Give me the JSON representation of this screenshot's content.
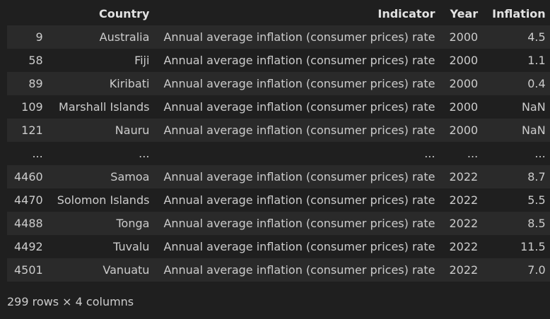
{
  "table": {
    "headers": [
      "",
      "Country",
      "Indicator",
      "Year",
      "Inflation"
    ],
    "rows": [
      {
        "index": "9",
        "country": "Australia",
        "indicator": "Annual average inflation (consumer prices) rate",
        "year": "2000",
        "inflation": "4.5"
      },
      {
        "index": "58",
        "country": "Fiji",
        "indicator": "Annual average inflation (consumer prices) rate",
        "year": "2000",
        "inflation": "1.1"
      },
      {
        "index": "89",
        "country": "Kiribati",
        "indicator": "Annual average inflation (consumer prices) rate",
        "year": "2000",
        "inflation": "0.4"
      },
      {
        "index": "109",
        "country": "Marshall Islands",
        "indicator": "Annual average inflation (consumer prices) rate",
        "year": "2000",
        "inflation": "NaN"
      },
      {
        "index": "121",
        "country": "Nauru",
        "indicator": "Annual average inflation (consumer prices) rate",
        "year": "2000",
        "inflation": "NaN"
      },
      {
        "index": "...",
        "country": "...",
        "indicator": "...",
        "year": "...",
        "inflation": "..."
      },
      {
        "index": "4460",
        "country": "Samoa",
        "indicator": "Annual average inflation (consumer prices) rate",
        "year": "2022",
        "inflation": "8.7"
      },
      {
        "index": "4470",
        "country": "Solomon Islands",
        "indicator": "Annual average inflation (consumer prices) rate",
        "year": "2022",
        "inflation": "5.5"
      },
      {
        "index": "4488",
        "country": "Tonga",
        "indicator": "Annual average inflation (consumer prices) rate",
        "year": "2022",
        "inflation": "8.5"
      },
      {
        "index": "4492",
        "country": "Tuvalu",
        "indicator": "Annual average inflation (consumer prices) rate",
        "year": "2022",
        "inflation": "11.5"
      },
      {
        "index": "4501",
        "country": "Vanuatu",
        "indicator": "Annual average inflation (consumer prices) rate",
        "year": "2022",
        "inflation": "7.0"
      }
    ]
  },
  "footer": {
    "shape_text": "299 rows × 4 columns"
  }
}
